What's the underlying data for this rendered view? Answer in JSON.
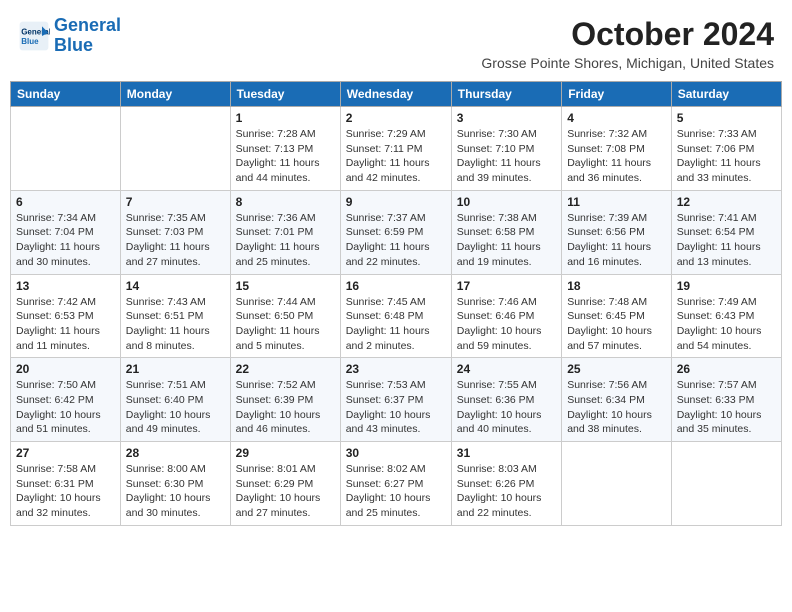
{
  "header": {
    "logo_line1": "General",
    "logo_line2": "Blue",
    "title": "October 2024",
    "subtitle": "Grosse Pointe Shores, Michigan, United States"
  },
  "days_of_week": [
    "Sunday",
    "Monday",
    "Tuesday",
    "Wednesday",
    "Thursday",
    "Friday",
    "Saturday"
  ],
  "weeks": [
    [
      {
        "day": "",
        "info": ""
      },
      {
        "day": "",
        "info": ""
      },
      {
        "day": "1",
        "info": "Sunrise: 7:28 AM\nSunset: 7:13 PM\nDaylight: 11 hours and 44 minutes."
      },
      {
        "day": "2",
        "info": "Sunrise: 7:29 AM\nSunset: 7:11 PM\nDaylight: 11 hours and 42 minutes."
      },
      {
        "day": "3",
        "info": "Sunrise: 7:30 AM\nSunset: 7:10 PM\nDaylight: 11 hours and 39 minutes."
      },
      {
        "day": "4",
        "info": "Sunrise: 7:32 AM\nSunset: 7:08 PM\nDaylight: 11 hours and 36 minutes."
      },
      {
        "day": "5",
        "info": "Sunrise: 7:33 AM\nSunset: 7:06 PM\nDaylight: 11 hours and 33 minutes."
      }
    ],
    [
      {
        "day": "6",
        "info": "Sunrise: 7:34 AM\nSunset: 7:04 PM\nDaylight: 11 hours and 30 minutes."
      },
      {
        "day": "7",
        "info": "Sunrise: 7:35 AM\nSunset: 7:03 PM\nDaylight: 11 hours and 27 minutes."
      },
      {
        "day": "8",
        "info": "Sunrise: 7:36 AM\nSunset: 7:01 PM\nDaylight: 11 hours and 25 minutes."
      },
      {
        "day": "9",
        "info": "Sunrise: 7:37 AM\nSunset: 6:59 PM\nDaylight: 11 hours and 22 minutes."
      },
      {
        "day": "10",
        "info": "Sunrise: 7:38 AM\nSunset: 6:58 PM\nDaylight: 11 hours and 19 minutes."
      },
      {
        "day": "11",
        "info": "Sunrise: 7:39 AM\nSunset: 6:56 PM\nDaylight: 11 hours and 16 minutes."
      },
      {
        "day": "12",
        "info": "Sunrise: 7:41 AM\nSunset: 6:54 PM\nDaylight: 11 hours and 13 minutes."
      }
    ],
    [
      {
        "day": "13",
        "info": "Sunrise: 7:42 AM\nSunset: 6:53 PM\nDaylight: 11 hours and 11 minutes."
      },
      {
        "day": "14",
        "info": "Sunrise: 7:43 AM\nSunset: 6:51 PM\nDaylight: 11 hours and 8 minutes."
      },
      {
        "day": "15",
        "info": "Sunrise: 7:44 AM\nSunset: 6:50 PM\nDaylight: 11 hours and 5 minutes."
      },
      {
        "day": "16",
        "info": "Sunrise: 7:45 AM\nSunset: 6:48 PM\nDaylight: 11 hours and 2 minutes."
      },
      {
        "day": "17",
        "info": "Sunrise: 7:46 AM\nSunset: 6:46 PM\nDaylight: 10 hours and 59 minutes."
      },
      {
        "day": "18",
        "info": "Sunrise: 7:48 AM\nSunset: 6:45 PM\nDaylight: 10 hours and 57 minutes."
      },
      {
        "day": "19",
        "info": "Sunrise: 7:49 AM\nSunset: 6:43 PM\nDaylight: 10 hours and 54 minutes."
      }
    ],
    [
      {
        "day": "20",
        "info": "Sunrise: 7:50 AM\nSunset: 6:42 PM\nDaylight: 10 hours and 51 minutes."
      },
      {
        "day": "21",
        "info": "Sunrise: 7:51 AM\nSunset: 6:40 PM\nDaylight: 10 hours and 49 minutes."
      },
      {
        "day": "22",
        "info": "Sunrise: 7:52 AM\nSunset: 6:39 PM\nDaylight: 10 hours and 46 minutes."
      },
      {
        "day": "23",
        "info": "Sunrise: 7:53 AM\nSunset: 6:37 PM\nDaylight: 10 hours and 43 minutes."
      },
      {
        "day": "24",
        "info": "Sunrise: 7:55 AM\nSunset: 6:36 PM\nDaylight: 10 hours and 40 minutes."
      },
      {
        "day": "25",
        "info": "Sunrise: 7:56 AM\nSunset: 6:34 PM\nDaylight: 10 hours and 38 minutes."
      },
      {
        "day": "26",
        "info": "Sunrise: 7:57 AM\nSunset: 6:33 PM\nDaylight: 10 hours and 35 minutes."
      }
    ],
    [
      {
        "day": "27",
        "info": "Sunrise: 7:58 AM\nSunset: 6:31 PM\nDaylight: 10 hours and 32 minutes."
      },
      {
        "day": "28",
        "info": "Sunrise: 8:00 AM\nSunset: 6:30 PM\nDaylight: 10 hours and 30 minutes."
      },
      {
        "day": "29",
        "info": "Sunrise: 8:01 AM\nSunset: 6:29 PM\nDaylight: 10 hours and 27 minutes."
      },
      {
        "day": "30",
        "info": "Sunrise: 8:02 AM\nSunset: 6:27 PM\nDaylight: 10 hours and 25 minutes."
      },
      {
        "day": "31",
        "info": "Sunrise: 8:03 AM\nSunset: 6:26 PM\nDaylight: 10 hours and 22 minutes."
      },
      {
        "day": "",
        "info": ""
      },
      {
        "day": "",
        "info": ""
      }
    ]
  ]
}
